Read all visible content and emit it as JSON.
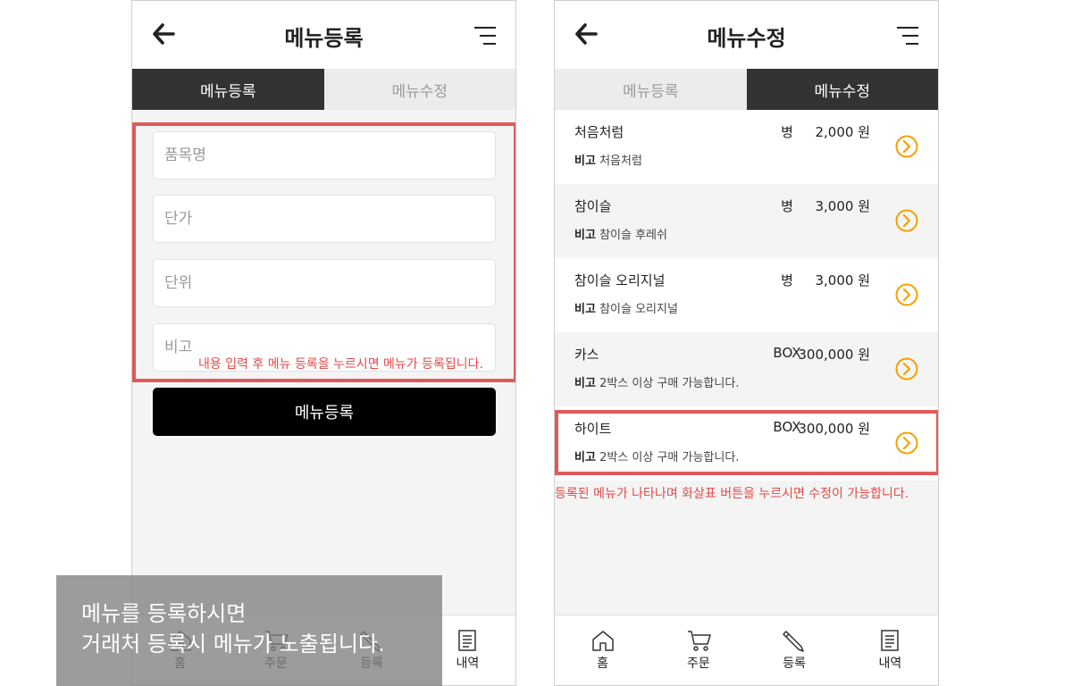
{
  "left": {
    "header": {
      "title": "메뉴등록"
    },
    "tabs": [
      {
        "label": "메뉴등록"
      },
      {
        "label": "메뉴수정"
      }
    ],
    "form": {
      "name_placeholder": "품목명",
      "price_placeholder": "단가",
      "unit_placeholder": "단위",
      "remark_placeholder": "비고"
    },
    "notice": "내용 입력 후 메뉴 등록을 누르시면 메뉴가 등록됩니다.",
    "submit_label": "메뉴등록"
  },
  "right": {
    "header": {
      "title": "메뉴수정"
    },
    "tabs": [
      {
        "label": "메뉴등록"
      },
      {
        "label": "메뉴수정"
      }
    ],
    "remark_label": "비고",
    "items": [
      {
        "name": "처음처럼",
        "unit": "병",
        "price": "2,000 원",
        "remark": "처음처럼"
      },
      {
        "name": "참이슬",
        "unit": "병",
        "price": "3,000 원",
        "remark": "참이슬 후레쉬"
      },
      {
        "name": "참이슬 오리지널",
        "unit": "병",
        "price": "3,000 원",
        "remark": "참이슬 오리지널"
      },
      {
        "name": "카스",
        "unit": "BOX",
        "price": "300,000 원",
        "remark": "2박스 이상 구매 가능합니다."
      },
      {
        "name": "하이트",
        "unit": "BOX",
        "price": "300,000 원",
        "remark": "2박스 이상 구매 가능합니다."
      }
    ],
    "notice": "등록된 메뉴가 나타나며 화살표 버튼을 누르시면 수정이 가능합니다."
  },
  "bottom_nav": [
    {
      "label": "홈"
    },
    {
      "label": "주문"
    },
    {
      "label": "등록"
    },
    {
      "label": "내역"
    }
  ],
  "overlay": {
    "line1": "메뉴를 등록하시면",
    "line2": "거래처 등록시 메뉴가 노출됩니다."
  },
  "colors": {
    "accent_orange": "#f5a000",
    "highlight_red": "#e05a5a",
    "dark_tab": "#333333"
  }
}
